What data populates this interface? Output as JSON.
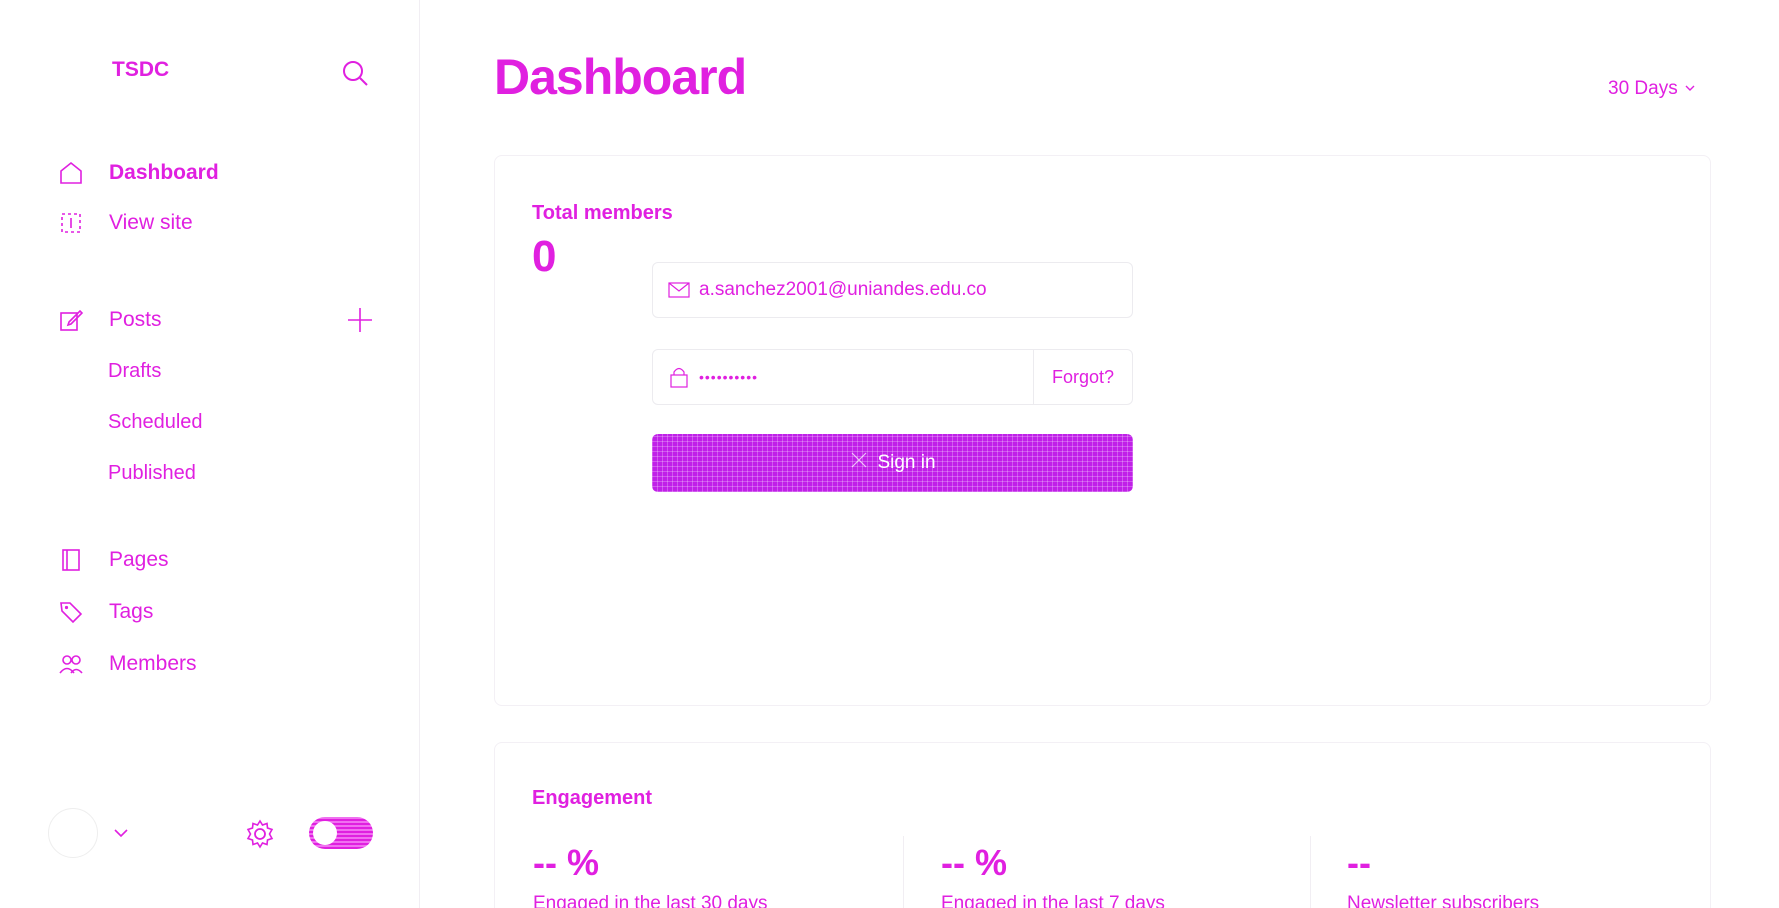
{
  "sidebar": {
    "brand": "TSDC",
    "nav": {
      "dashboard": "Dashboard",
      "view_site": "View site",
      "posts": "Posts",
      "pages": "Pages",
      "tags": "Tags",
      "members": "Members"
    },
    "posts_sub": {
      "drafts": "Drafts",
      "scheduled": "Scheduled",
      "published": "Published"
    },
    "icons": [
      "search-icon",
      "home-icon",
      "view-site-icon",
      "edit-icon",
      "plus-icon",
      "pages-icon",
      "tag-icon",
      "members-icon",
      "chevron-down-icon",
      "gear-icon"
    ]
  },
  "header": {
    "title": "Dashboard",
    "range": "30 Days"
  },
  "members_card": {
    "label": "Total members",
    "value": "0"
  },
  "login": {
    "email": "a.sanchez2001@uniandes.edu.co",
    "password_mask": "••••••••••",
    "forgot": "Forgot?",
    "signin": "Sign in"
  },
  "engagement_card": {
    "label": "Engagement",
    "stats": [
      {
        "value": "-- %",
        "label": "Engaged in the last 30 days"
      },
      {
        "value": "-- %",
        "label": "Engaged in the last 7 days"
      },
      {
        "value": "--",
        "label": "Newsletter subscribers"
      }
    ]
  },
  "colors": {
    "accent": "#e020e0",
    "button": "#c020e8"
  }
}
